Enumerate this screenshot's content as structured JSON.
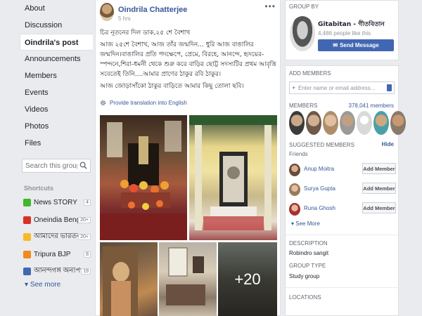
{
  "nav": {
    "items": [
      {
        "label": "About"
      },
      {
        "label": "Discussion"
      },
      {
        "label": "Oindrila's post",
        "active": true
      },
      {
        "label": "Announcements"
      },
      {
        "label": "Members"
      },
      {
        "label": "Events"
      },
      {
        "label": "Videos"
      },
      {
        "label": "Photos"
      },
      {
        "label": "Files"
      }
    ],
    "search_placeholder": "Search this group",
    "shortcuts_title": "Shortcuts",
    "shortcuts": [
      {
        "label": "News STORY",
        "count": "4",
        "color": "#42b72a"
      },
      {
        "label": "Oneindia Bengali",
        "count": "20+",
        "color": "#d93025"
      },
      {
        "label": "আমাদের ভারতবর্ষ -...",
        "count": "20+",
        "color": "#f7b928"
      },
      {
        "label": "Tripura BJP",
        "count": "8",
        "color": "#f28a1c"
      },
      {
        "label": "আনন্দগঙ্গ অন্যপথ",
        "count": "19",
        "color": "#4267b2"
      }
    ],
    "see_more": "See more"
  },
  "post": {
    "author": "Oindrila Chatterjee",
    "time": "5 hrs",
    "menu": "•••",
    "text_lines": [
      "চির নূতনের দিল ডাক,২৫ শে বৈশাখ",
      "আজ ২৫শে বৈশাখ, আজ তাঁর জন্মদিন... ধুরি আজ বাঙালির জন্মদিন।বাঙালির প্রতি পদক্ষেপে, প্রেমে, বিরহে, আনন্দে, হৃদয়ের-স্পন্দনে,শিরা-ধমনী থেকে শুরু করে বাড়ির ছোট্ট সদস্যটির প্রথম আবৃত্তি সবেতেই তিনি....আমার প্রাণের ঠাকুর রবি ঠাকুর।",
      "আজ জোড়াসাঁকো ঠাকুর বাড়িতে আমার কিছু তোলা ছবি।"
    ],
    "translate": "Provide translation into English",
    "more_photos": "+20"
  },
  "group_by": {
    "title": "GROUP BY",
    "name": "Gitabitan - গীতবিতান",
    "likes": "4,486 people like this",
    "send_button": "Send Message"
  },
  "members_card": {
    "add_title": "ADD MEMBERS",
    "add_placeholder": "Enter name or email address...",
    "members_title": "MEMBERS",
    "members_count": "378,041 members",
    "face_colors": [
      "#3b3b3b",
      "#6e5a4a",
      "#b08d6a",
      "#9a9a9a",
      "#d9d9d9",
      "#4aa0a8",
      "#8a7a6a"
    ],
    "suggested_title": "SUGGESTED MEMBERS",
    "hide": "Hide",
    "friends_label": "Friends",
    "suggestions": [
      {
        "name": "Anup Moitra",
        "button": "Add Member",
        "color": "#6a4a3a"
      },
      {
        "name": "Surya Gupta",
        "button": "Add Member",
        "color": "#9a7a5a"
      },
      {
        "name": "Runa Ghosh",
        "button": "Add Member",
        "color": "#a83030"
      }
    ],
    "see_more": "See More",
    "description_title": "DESCRIPTION",
    "description": "Robindro sangit",
    "type_title": "GROUP TYPE",
    "type": "Study group",
    "locations_title": "LOCATIONS"
  }
}
